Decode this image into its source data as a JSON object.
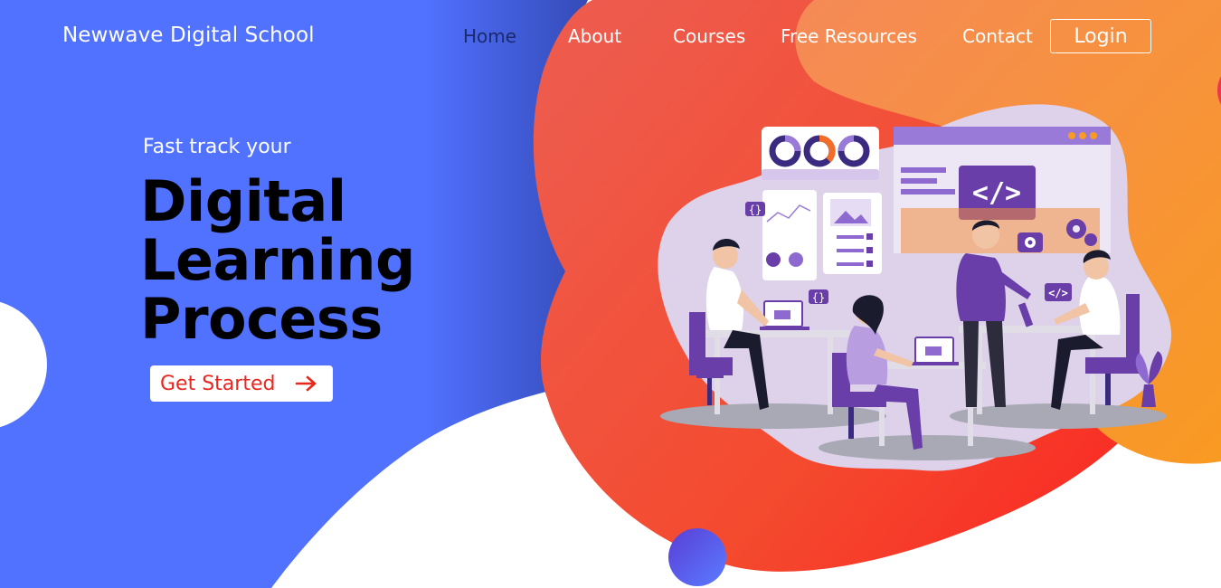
{
  "brand": {
    "name": "Newwave Digital School"
  },
  "nav": {
    "items": [
      {
        "label": "Home",
        "active": true
      },
      {
        "label": "About"
      },
      {
        "label": "Courses"
      },
      {
        "label": "Free Resources"
      },
      {
        "label": "Contact"
      }
    ],
    "login_label": "Login"
  },
  "hero": {
    "tagline": "Fast track your",
    "headline": [
      "Digital",
      "Learning",
      "Process"
    ],
    "cta_label": "Get Started",
    "cta_icon": "arrow-right-icon"
  },
  "illustration": {
    "code_label": "</>",
    "small_code_label": "</>",
    "brace_label": "{}"
  },
  "colors": {
    "primary_blue": "#5171ff",
    "accent_red": "#f0282a",
    "accent_orange": "#f89a2a",
    "nav_active": "#1b2a6e",
    "purple": "#6a3ea8"
  }
}
